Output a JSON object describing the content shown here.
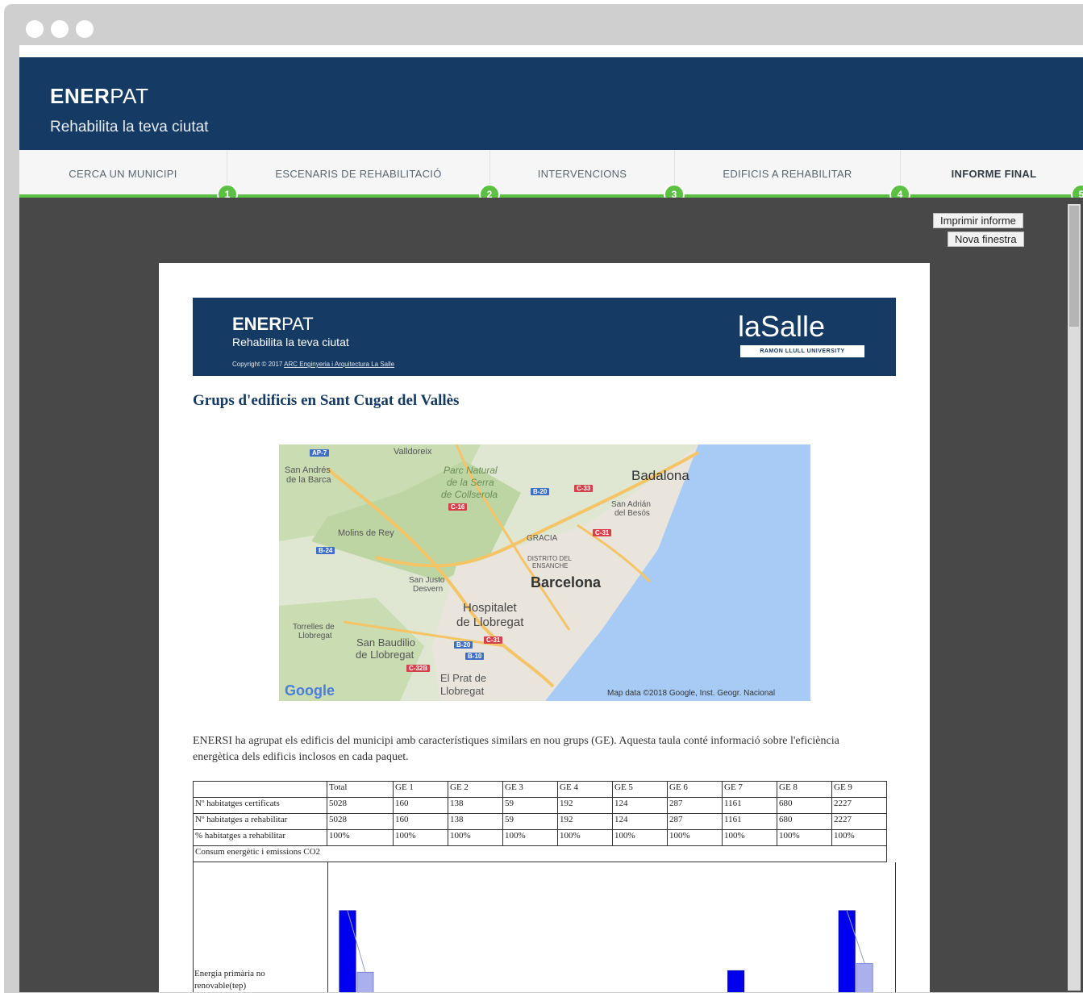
{
  "app": {
    "brand_bold": "ENER",
    "brand_thin": "PAT",
    "tagline": "Rehabilita la teva ciutat"
  },
  "steps": [
    {
      "label": "CERCA UN MUNICIPI",
      "num": "1"
    },
    {
      "label": "ESCENARIS DE REHABILITACIÓ",
      "num": "2"
    },
    {
      "label": "INTERVENCIONS",
      "num": "3"
    },
    {
      "label": "EDIFICIS A REHABILITAR",
      "num": "4"
    },
    {
      "label": "INFORME FINAL",
      "num": "5"
    }
  ],
  "actions": {
    "print": "Imprimir informe",
    "new_window": "Nova finestra"
  },
  "report": {
    "brand_bold": "ENER",
    "brand_thin": "PAT",
    "tagline": "Rehabilita la teva ciutat",
    "copyright": "Copyright © 2017",
    "copyright_link": "ARC Enginyeria i Arquitectura La Salle",
    "partner_logo": "laSalle",
    "partner_sub": "RAMON LLULL UNIVERSITY",
    "title": "Grups d'edificis en Sant Cugat del Vallès",
    "paragraph": "ENERSI ha agrupat els edificis del municipi amb característiques similars en nou grups (GE). Aquesta taula conté informació sobre l'eficiència energètica dels edificis inclosos en cada paquet."
  },
  "map": {
    "labels": {
      "badalona": "Badalona",
      "barcelona": "Barcelona",
      "hospitalet": "Hospitalet",
      "hospitalet2": "de Llobregat",
      "valldoreix": "Valldoreix",
      "sant_andreu": "San Andrés",
      "sant_andreu2": "de la Barca",
      "parc": "Parc Natural",
      "parc2": "de la Serra",
      "parc3": "de Collserola",
      "sant_adria": "San Adrián",
      "sant_adria2": "del Besós",
      "molins": "Molins de Rey",
      "gracia": "GRACIA",
      "eixample": "DISTRITO DEL",
      "eixample2": "ENSANCHE",
      "sant_just": "San Justo",
      "sant_just2": "Desvern",
      "torrelles": "Torrelles de",
      "torrelles2": "Llobregat",
      "sant_boi": "San Baudilio",
      "sant_boi2": "de Llobregat",
      "prat": "El Prat de",
      "prat2": "Llobregat"
    },
    "google": "Google",
    "attribution": "Map data ©2018 Google, Inst. Geogr. Nacional",
    "colors": {
      "water": "#a8cbf5",
      "urban": "#e9e5dd",
      "green": "#c9dcb2",
      "road": "#f4c466"
    }
  },
  "table": {
    "headers": [
      "",
      "Total",
      "GE 1",
      "GE 2",
      "GE 3",
      "GE 4",
      "GE 5",
      "GE 6",
      "GE 7",
      "GE 8",
      "GE 9"
    ],
    "rows": [
      [
        "Nº habitatges certificats",
        "5028",
        "160",
        "138",
        "59",
        "192",
        "124",
        "287",
        "1161",
        "680",
        "2227"
      ],
      [
        "Nº habitatges a rehabilitar",
        "5028",
        "160",
        "138",
        "59",
        "192",
        "124",
        "287",
        "1161",
        "680",
        "2227"
      ],
      [
        "% habitatges a rehabilitar",
        "100%",
        "100%",
        "100%",
        "100%",
        "100%",
        "100%",
        "100%",
        "100%",
        "100%",
        "100%"
      ]
    ],
    "section": "Consum energètic i emissions CO2",
    "energy_label_1": "Energia primària no",
    "energy_label_2": "renovable(tep)"
  },
  "chart_data": {
    "type": "bar",
    "title": "",
    "categories": [
      "Total",
      "GE 1",
      "GE 2",
      "GE 3",
      "GE 4",
      "GE 5",
      "GE 6",
      "GE 7",
      "GE 8",
      "GE 9"
    ],
    "series": [
      {
        "values": [
          123,
          null,
          null,
          null,
          null,
          null,
          null,
          48,
          9,
          123
        ]
      },
      {
        "values": [
          46,
          null,
          null,
          null,
          null,
          null,
          null,
          null,
          null,
          57
        ]
      }
    ],
    "colors": [
      "#0000ee",
      "#aab0ee"
    ],
    "ylabel": "Energia primària no renovable(tep)"
  }
}
